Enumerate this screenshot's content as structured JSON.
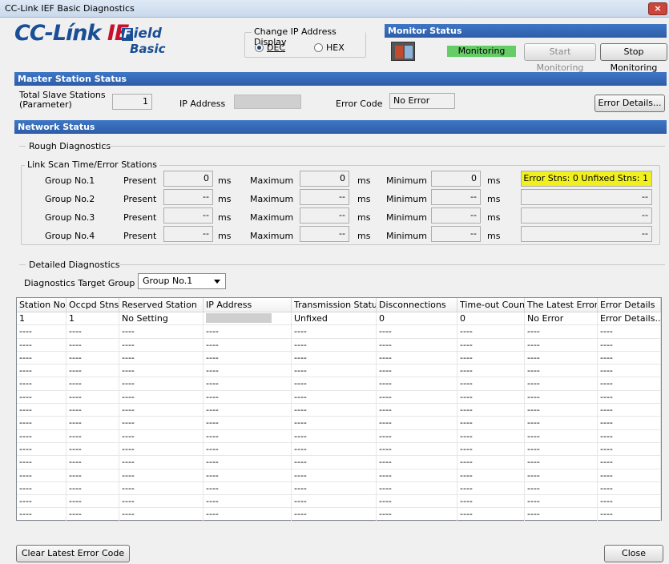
{
  "window": {
    "title": "CC-Link IEF Basic Diagnostics",
    "close_glyph": "×"
  },
  "logo": {
    "cc": "CC-Línk",
    "ie": "IE",
    "field_letter": "F",
    "field_rest": "ield",
    "basic": "Basic"
  },
  "ip_display": {
    "title": "Change IP Address Display",
    "options": [
      {
        "label": "DEC",
        "selected": true
      },
      {
        "label": "HEX",
        "selected": false
      }
    ]
  },
  "monitor": {
    "title": "Monitor Status",
    "status_text": "Monitoring",
    "status_color": "#66cc66",
    "start_label": "Start Monitoring",
    "stop_label": "Stop Monitoring"
  },
  "master": {
    "section_title": "Master Station Status",
    "total_slave_label_1": "Total Slave Stations",
    "total_slave_label_2": "(Parameter)",
    "total_slave_value": "1",
    "ip_label": "IP Address",
    "error_code_label": "Error Code",
    "error_code_value": "No Error",
    "error_details_label": "Error Details..."
  },
  "network": {
    "section_title": "Network Status",
    "rough_title": "Rough Diagnostics",
    "link_scan_title": "Link Scan Time/Error Stations",
    "present_label": "Present",
    "maximum_label": "Maximum",
    "minimum_label": "Minimum",
    "unit": "ms",
    "groups": [
      {
        "name": "Group No.1",
        "present": "0",
        "maximum": "0",
        "minimum": "0",
        "status": "Error Stns: 0  Unfixed Stns: 1"
      },
      {
        "name": "Group No.2",
        "present": "--",
        "maximum": "--",
        "minimum": "--",
        "status": "--"
      },
      {
        "name": "Group No.3",
        "present": "--",
        "maximum": "--",
        "minimum": "--",
        "status": "--"
      },
      {
        "name": "Group No.4",
        "present": "--",
        "maximum": "--",
        "minimum": "--",
        "status": "--"
      }
    ],
    "status_highlight_color": "#f0f020",
    "detailed_title": "Detailed Diagnostics",
    "target_group_label": "Diagnostics Target Group",
    "target_group_value": "Group No.1"
  },
  "table": {
    "headers": [
      "Station No.",
      "Occpd Stns",
      "Reserved Station",
      "IP Address",
      "Transmission Status",
      "Disconnections",
      "Time-out Count",
      "The Latest Error",
      "Error Details"
    ],
    "rows": [
      [
        "1",
        "1",
        "No Setting",
        "",
        "Unfixed",
        "0",
        "0",
        "No Error",
        "Error Details..."
      ],
      [
        "----",
        "----",
        "----",
        "----",
        "----",
        "----",
        "----",
        "----",
        "----"
      ],
      [
        "----",
        "----",
        "----",
        "----",
        "----",
        "----",
        "----",
        "----",
        "----"
      ],
      [
        "----",
        "----",
        "----",
        "----",
        "----",
        "----",
        "----",
        "----",
        "----"
      ],
      [
        "----",
        "----",
        "----",
        "----",
        "----",
        "----",
        "----",
        "----",
        "----"
      ],
      [
        "----",
        "----",
        "----",
        "----",
        "----",
        "----",
        "----",
        "----",
        "----"
      ],
      [
        "----",
        "----",
        "----",
        "----",
        "----",
        "----",
        "----",
        "----",
        "----"
      ],
      [
        "----",
        "----",
        "----",
        "----",
        "----",
        "----",
        "----",
        "----",
        "----"
      ],
      [
        "----",
        "----",
        "----",
        "----",
        "----",
        "----",
        "----",
        "----",
        "----"
      ],
      [
        "----",
        "----",
        "----",
        "----",
        "----",
        "----",
        "----",
        "----",
        "----"
      ],
      [
        "----",
        "----",
        "----",
        "----",
        "----",
        "----",
        "----",
        "----",
        "----"
      ],
      [
        "----",
        "----",
        "----",
        "----",
        "----",
        "----",
        "----",
        "----",
        "----"
      ],
      [
        "----",
        "----",
        "----",
        "----",
        "----",
        "----",
        "----",
        "----",
        "----"
      ],
      [
        "----",
        "----",
        "----",
        "----",
        "----",
        "----",
        "----",
        "----",
        "----"
      ],
      [
        "----",
        "----",
        "----",
        "----",
        "----",
        "----",
        "----",
        "----",
        "----"
      ],
      [
        "----",
        "----",
        "----",
        "----",
        "----",
        "----",
        "----",
        "----",
        "----"
      ]
    ]
  },
  "footer": {
    "clear_label": "Clear Latest Error Code",
    "close_label": "Close"
  }
}
